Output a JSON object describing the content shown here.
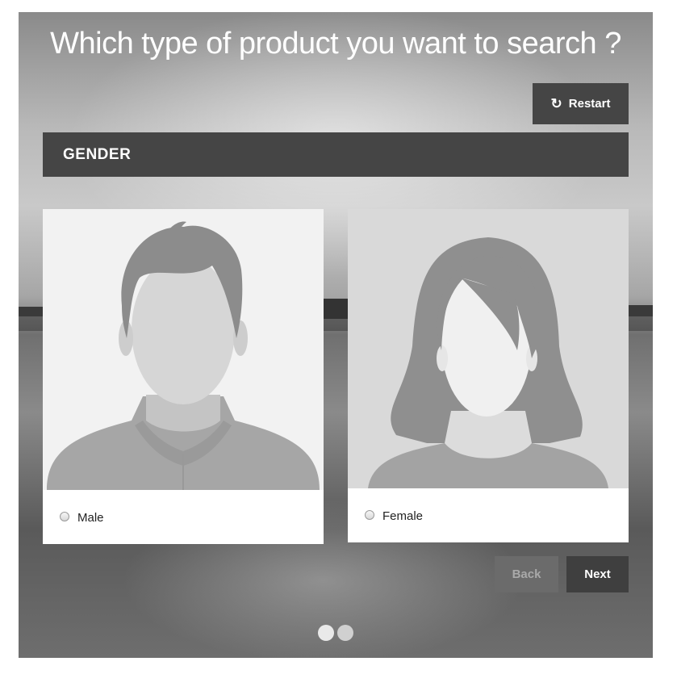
{
  "page": {
    "title": "Which type of product you want to search ?"
  },
  "restart": {
    "label": "Restart",
    "icon": "restart-icon"
  },
  "section": {
    "title": "GENDER"
  },
  "options": [
    {
      "label": "Male",
      "selected": false,
      "icon": "male-avatar-icon"
    },
    {
      "label": "Female",
      "selected": false,
      "icon": "female-avatar-icon"
    }
  ],
  "nav": {
    "back_label": "Back",
    "next_label": "Next"
  },
  "pagination": {
    "total": 2,
    "current": 1
  },
  "colors": {
    "dark_bar": "#454545",
    "button_dark": "#3f3f3f",
    "button_disabled": "#6b6b6b",
    "title_text": "#ffffff"
  }
}
